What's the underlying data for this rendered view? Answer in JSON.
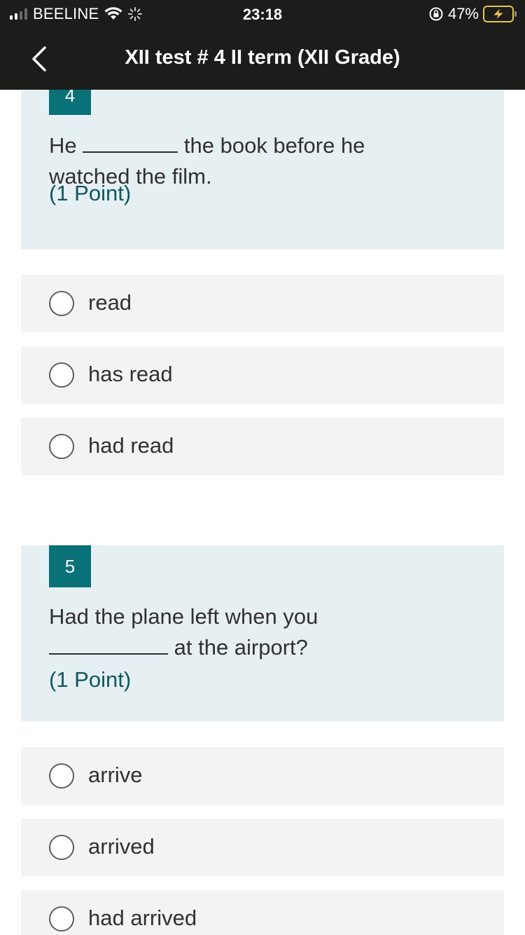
{
  "status_bar": {
    "carrier": "BEELINE",
    "time": "23:18",
    "battery_percent": "47%",
    "icons": [
      "signal-icon",
      "wifi-icon",
      "activity-spinner-icon",
      "orientation-lock-icon",
      "battery-charging-icon"
    ]
  },
  "nav": {
    "back_icon": "chevron-left-icon",
    "title": "XII test # 4 II term (XII Grade)"
  },
  "questions": [
    {
      "number": "4",
      "text_before": "He",
      "text_after": "the book before he",
      "text_line2": "watched the film.",
      "points": "(1 Point)",
      "options": [
        "read",
        "has read",
        "had read"
      ]
    },
    {
      "number": "5",
      "text_line1": "Had the plane left when you",
      "text_after": "at the airport?",
      "points": "(1 Point)",
      "options": [
        "arrive",
        "arrived",
        "had arrived"
      ]
    }
  ],
  "colors": {
    "header_bg": "#1c1c1a",
    "question_bg": "#e6eff2",
    "number_badge": "#097279",
    "points_text": "#0b5a5f",
    "option_bg": "#f3f3f3"
  }
}
